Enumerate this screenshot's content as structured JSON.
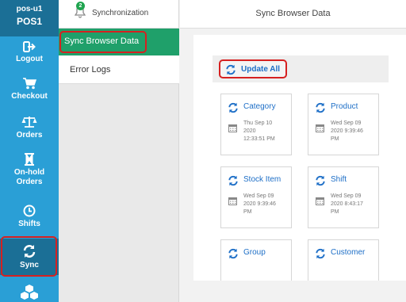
{
  "sidebar": {
    "header": {
      "line1": "pos-u1",
      "line2": "POS1"
    },
    "items": [
      {
        "label": "Logout",
        "icon": "logout-icon"
      },
      {
        "label": "Checkout",
        "icon": "cart-icon"
      },
      {
        "label": "Orders",
        "icon": "scale-icon"
      },
      {
        "label": "On-hold Orders",
        "line1": "On-hold",
        "line2": "Orders",
        "icon": "hourglass-icon"
      },
      {
        "label": "Shifts",
        "icon": "clock-icon"
      },
      {
        "label": "Sync",
        "icon": "sync-icon",
        "active": true
      },
      {
        "label": "",
        "icon": "cubes-icon"
      }
    ]
  },
  "submenu": {
    "header": "Synchronization",
    "notification_count": "2",
    "items": [
      {
        "label": "Sync Browser Data",
        "active": true
      },
      {
        "label": "Error Logs"
      }
    ]
  },
  "main": {
    "title": "Sync Browser Data",
    "update_all_label": "Update All",
    "cards": [
      {
        "title": "Category",
        "date_lines": [
          "Thu Sep 10",
          "2020",
          "12:33:51 PM"
        ]
      },
      {
        "title": "Product",
        "date_lines": [
          "Wed Sep 09",
          "2020 9:39:46",
          "PM"
        ]
      },
      {
        "title": "Stock Item",
        "date_lines": [
          "Wed Sep 09",
          "2020 9:39:46",
          "PM"
        ]
      },
      {
        "title": "Shift",
        "date_lines": [
          "Wed Sep 09",
          "2020 8:43:17",
          "PM"
        ]
      },
      {
        "title": "Group",
        "date_lines": []
      },
      {
        "title": "Customer",
        "date_lines": []
      }
    ]
  },
  "colors": {
    "sidebar_bg": "#2a9fd6",
    "sidebar_active": "#1b6f96",
    "menu_active": "#1fa06a",
    "link_blue": "#1e6fc7",
    "highlight_red": "#d62020"
  }
}
